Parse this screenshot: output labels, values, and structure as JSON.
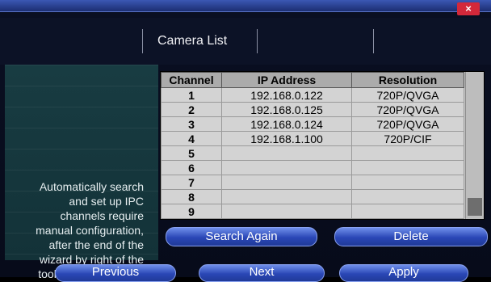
{
  "window": {
    "title": "Camera List",
    "close_label": "×"
  },
  "side_panel": {
    "lines": [
      "Automatically search",
      "and set up IPC",
      "channels require",
      "manual configuration,",
      "after the end of the",
      "wizard by right of the",
      "toolbar configuration."
    ]
  },
  "table": {
    "headers": {
      "channel": "Channel",
      "ip": "IP Address",
      "resolution": "Resolution"
    },
    "rows": [
      {
        "channel": "1",
        "ip": "192.168.0.122",
        "resolution": "720P/QVGA"
      },
      {
        "channel": "2",
        "ip": "192.168.0.125",
        "resolution": "720P/QVGA"
      },
      {
        "channel": "3",
        "ip": "192.168.0.124",
        "resolution": "720P/QVGA"
      },
      {
        "channel": "4",
        "ip": "192.168.1.100",
        "resolution": "720P/CIF"
      },
      {
        "channel": "5",
        "ip": "",
        "resolution": ""
      },
      {
        "channel": "6",
        "ip": "",
        "resolution": ""
      },
      {
        "channel": "7",
        "ip": "",
        "resolution": ""
      },
      {
        "channel": "8",
        "ip": "",
        "resolution": ""
      },
      {
        "channel": "9",
        "ip": "",
        "resolution": ""
      }
    ]
  },
  "buttons": {
    "search_again": "Search Again",
    "delete": "Delete",
    "previous": "Previous",
    "next": "Next",
    "apply": "Apply"
  }
}
